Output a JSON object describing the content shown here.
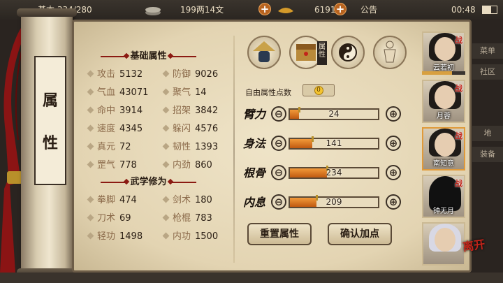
{
  "topbar": {
    "left_text": "基本 334/280",
    "money": "199两14文",
    "ingots": "6191两",
    "notice": "公告",
    "time": "00:48"
  },
  "scroll": {
    "title_chars": [
      "属",
      "性"
    ]
  },
  "basic": {
    "title": "基础属性",
    "stats": [
      {
        "label": "攻击",
        "value": "5132"
      },
      {
        "label": "防御",
        "value": "9026"
      },
      {
        "label": "气血",
        "value": "43071"
      },
      {
        "label": "聚气",
        "value": "14"
      },
      {
        "label": "命中",
        "value": "3914"
      },
      {
        "label": "招架",
        "value": "3842"
      },
      {
        "label": "速度",
        "value": "4345"
      },
      {
        "label": "躲闪",
        "value": "4576"
      },
      {
        "label": "真元",
        "value": "72"
      },
      {
        "label": "韧性",
        "value": "1393"
      },
      {
        "label": "罡气",
        "value": "778"
      },
      {
        "label": "内劲",
        "value": "860"
      }
    ]
  },
  "martial": {
    "title": "武学修为",
    "stats": [
      {
        "label": "拳脚",
        "value": "474"
      },
      {
        "label": "剑术",
        "value": "180"
      },
      {
        "label": "刀术",
        "value": "69"
      },
      {
        "label": "枪棍",
        "value": "783"
      },
      {
        "label": "轻功",
        "value": "1498"
      },
      {
        "label": "内功",
        "value": "1500"
      }
    ]
  },
  "tabs": {
    "active_tag": "属性",
    "icons": [
      "hat-character-icon",
      "chest-icon",
      "taiji-icon",
      "body-meridian-icon"
    ]
  },
  "free_points": {
    "label": "自由属性点数",
    "value": "0"
  },
  "attributes": [
    {
      "name": "臂力",
      "value": "24",
      "fill": 0.1
    },
    {
      "name": "身法",
      "value": "141",
      "fill": 0.25
    },
    {
      "name": "根骨",
      "value": "234",
      "fill": 0.42
    },
    {
      "name": "内息",
      "value": "209",
      "fill": 0.3
    }
  ],
  "minus_glyph": "⊖",
  "plus_glyph": "⊕",
  "buttons": {
    "reset": "重置属性",
    "confirm": "确认加点"
  },
  "characters": [
    {
      "name": "云若初",
      "war": "战",
      "selected": false
    },
    {
      "name": "月蓉",
      "war": "战",
      "selected": false
    },
    {
      "name": "南知意",
      "war": "战",
      "selected": true
    },
    {
      "name": "钟无月",
      "war": "战",
      "selected": false
    },
    {
      "name": "",
      "war": "",
      "selected": false
    }
  ],
  "side_tabs": [
    "菜单",
    "社区",
    "地",
    "装备"
  ],
  "leave": "离开",
  "colors": {
    "accent": "#e07a20",
    "war": "#c2241a",
    "panel": "#efe4c8"
  }
}
